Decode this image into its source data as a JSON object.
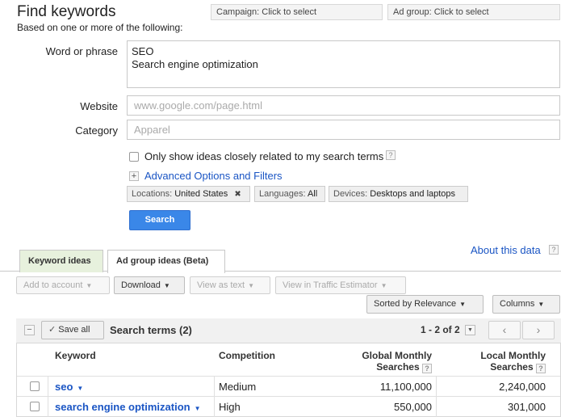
{
  "header": {
    "title": "Find keywords",
    "subtitle": "Based on one or more of the following:",
    "campaign_select": "Campaign: Click to select",
    "adgroup_select": "Ad group: Click to select"
  },
  "form": {
    "word_label": "Word or phrase",
    "word_lines": [
      "SEO",
      "Search engine optimization"
    ],
    "website_label": "Website",
    "website_placeholder": "www.google.com/page.html",
    "category_label": "Category",
    "category_placeholder": "Apparel",
    "closely_related_label": "Only show ideas closely related to my search terms",
    "help_glyph": "?",
    "advanced_toggle": "+",
    "advanced_link": "Advanced Options and Filters",
    "locations_label": "Locations:",
    "locations_value": "United States",
    "remove_glyph": "✖",
    "languages_label": "Languages:",
    "languages_value": "All",
    "devices_label": "Devices:",
    "devices_value": "Desktops and laptops",
    "search_button": "Search"
  },
  "tabs": {
    "keyword_ideas": "Keyword ideas",
    "ad_group_ideas": "Ad group ideas (Beta)",
    "about": "About this data"
  },
  "toolbar": {
    "add_to_account": "Add to account",
    "download": "Download",
    "view_as_text": "View as text",
    "view_in_estimator": "View in Traffic Estimator",
    "sorted_by": "Sorted by Relevance",
    "columns": "Columns",
    "caret": "▼"
  },
  "results": {
    "minus_glyph": "−",
    "save_all": "Save all",
    "check_glyph": "✓",
    "heading": "Search terms (2)",
    "pagination": "1 - 2 of 2",
    "prev_glyph": "‹",
    "next_glyph": "›",
    "columns": {
      "keyword": "Keyword",
      "competition": "Competition",
      "global_line1": "Global Monthly",
      "global_line2": "Searches",
      "local_line1": "Local Monthly",
      "local_line2": "Searches"
    },
    "rows": [
      {
        "keyword": "seo",
        "competition": "Medium",
        "global": "11,100,000",
        "local": "2,240,000"
      },
      {
        "keyword": "search engine optimization",
        "competition": "High",
        "global": "550,000",
        "local": "301,000"
      }
    ]
  },
  "colors": {
    "accent": "#3a87e8",
    "link": "#1a55c4",
    "tab_inactive": "#e7f1dd"
  }
}
